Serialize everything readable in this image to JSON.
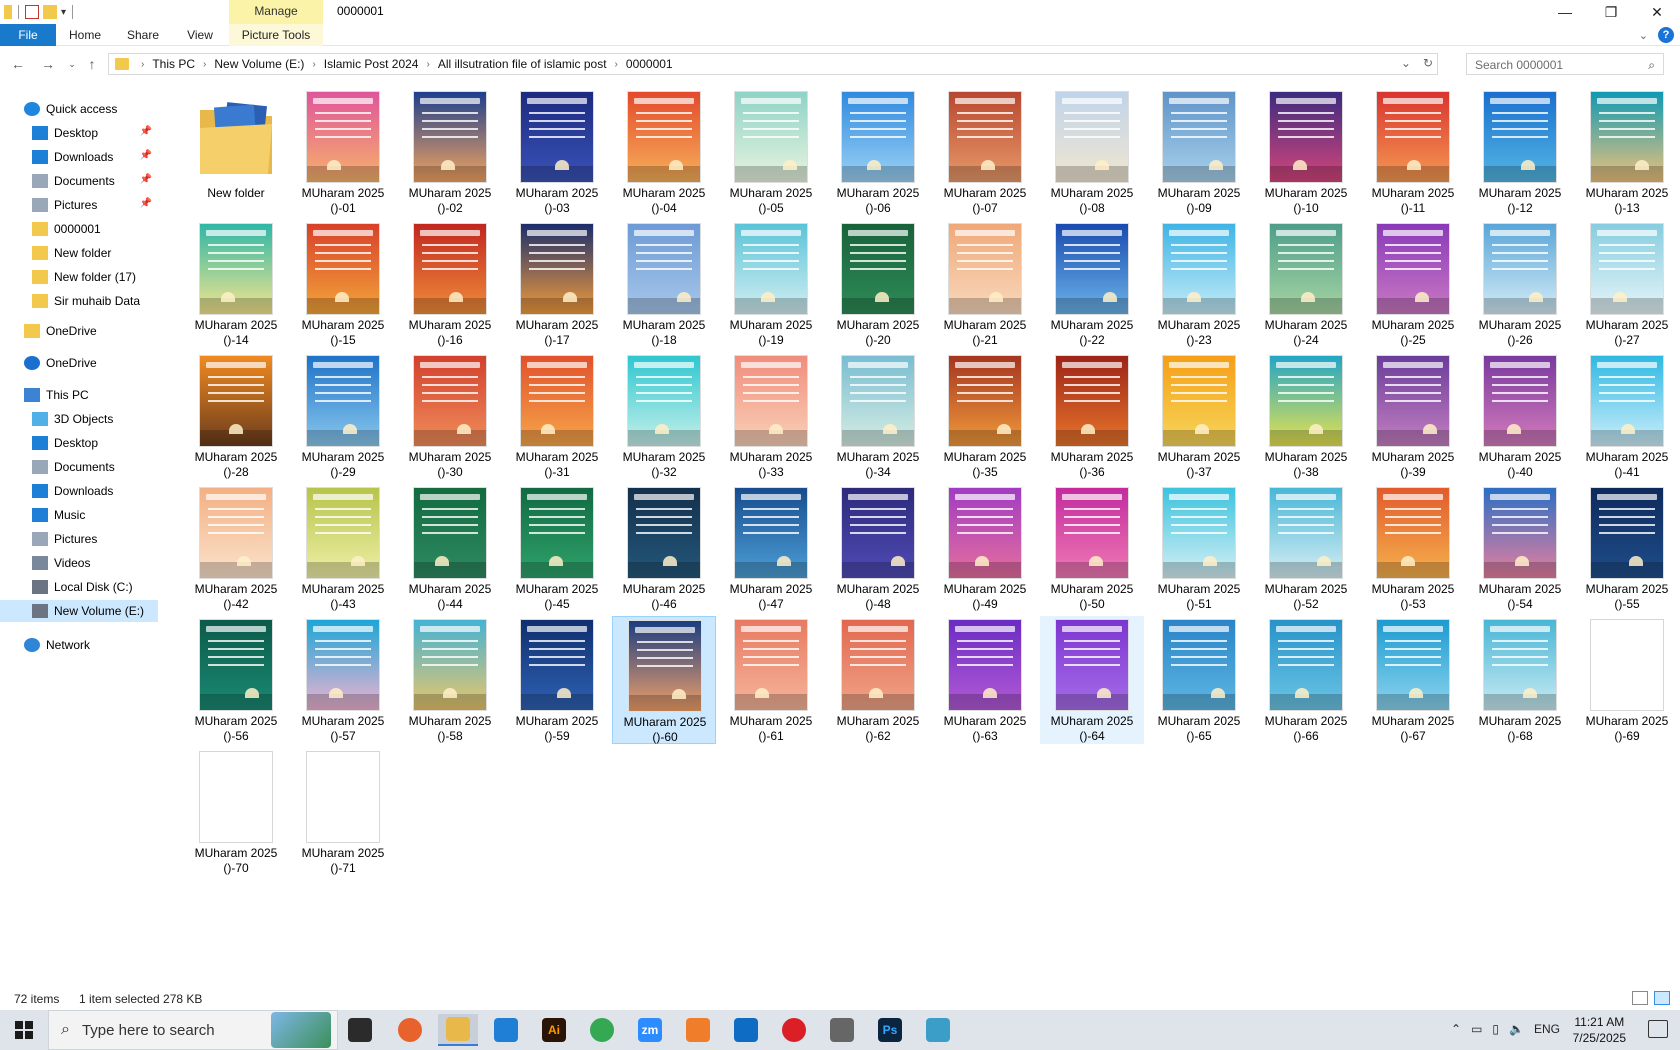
{
  "window": {
    "title": "0000001",
    "manage_label": "Manage",
    "controls": [
      "minimize-icon",
      "restore-icon",
      "close-icon"
    ]
  },
  "ribbon": {
    "file": "File",
    "home": "Home",
    "share": "Share",
    "view": "View",
    "picture_tools": "Picture Tools"
  },
  "address": {
    "crumbs": [
      "This PC",
      "New Volume (E:)",
      "Islamic Post 2024",
      "All illsutration file of islamic post",
      "0000001"
    ]
  },
  "search": {
    "placeholder": "Search 0000001"
  },
  "sidebar": {
    "items": [
      {
        "label": "Quick access",
        "icon": "star-icon"
      },
      {
        "label": "Desktop",
        "icon": "desktop-icon",
        "pinned": true
      },
      {
        "label": "Downloads",
        "icon": "download-icon",
        "pinned": true
      },
      {
        "label": "Documents",
        "icon": "documents-icon",
        "pinned": true
      },
      {
        "label": "Pictures",
        "icon": "pictures-icon",
        "pinned": true
      },
      {
        "label": "0000001",
        "icon": "folder-icon"
      },
      {
        "label": "New folder",
        "icon": "folder-icon"
      },
      {
        "label": "New folder (17)",
        "icon": "folder-icon"
      },
      {
        "label": "Sir muhaib Data",
        "icon": "folder-icon"
      },
      {
        "label": "OneDrive",
        "icon": "folder-icon"
      },
      {
        "label": "OneDrive",
        "icon": "cloud-icon"
      },
      {
        "label": "This PC",
        "icon": "computer-icon"
      },
      {
        "label": "3D Objects",
        "icon": "cube-icon"
      },
      {
        "label": "Desktop",
        "icon": "desktop-icon"
      },
      {
        "label": "Documents",
        "icon": "documents-icon"
      },
      {
        "label": "Downloads",
        "icon": "download-icon"
      },
      {
        "label": "Music",
        "icon": "music-icon"
      },
      {
        "label": "Pictures",
        "icon": "pictures-icon"
      },
      {
        "label": "Videos",
        "icon": "videos-icon"
      },
      {
        "label": "Local Disk (C:)",
        "icon": "drive-icon"
      },
      {
        "label": "New Volume (E:)",
        "icon": "drive-icon",
        "selected": true
      },
      {
        "label": "Network",
        "icon": "network-icon"
      }
    ]
  },
  "files": {
    "folder": {
      "label": "New folder"
    },
    "images": [
      {
        "label": "MUharam 2025\n()-01",
        "colors": [
          "#e0559a",
          "#f6b26b"
        ]
      },
      {
        "label": "MUharam 2025\n()-02",
        "colors": [
          "#1d3f8c",
          "#f4a460"
        ]
      },
      {
        "label": "MUharam 2025\n()-03",
        "colors": [
          "#1c2a80",
          "#3a53b8"
        ]
      },
      {
        "label": "MUharam 2025\n()-04",
        "colors": [
          "#e34a2b",
          "#f7b15a"
        ]
      },
      {
        "label": "MUharam 2025\n()-05",
        "colors": [
          "#8fd3c7",
          "#e8f4df"
        ]
      },
      {
        "label": "MUharam 2025\n()-06",
        "colors": [
          "#2f8ae0",
          "#9bd2f5"
        ]
      },
      {
        "label": "MUharam 2025\n()-07",
        "colors": [
          "#b8472f",
          "#e89a6a"
        ]
      },
      {
        "label": "MUharam 2025\n()-08",
        "colors": [
          "#bfd4ea",
          "#f1e6d0"
        ]
      },
      {
        "label": "MUharam 2025\n()-09",
        "colors": [
          "#5f94c9",
          "#a8d1ea"
        ]
      },
      {
        "label": "MUharam 2025\n()-10",
        "colors": [
          "#3c2b7f",
          "#d5467b"
        ]
      },
      {
        "label": "MUharam 2025\n()-11",
        "colors": [
          "#d9342f",
          "#f59a52"
        ]
      },
      {
        "label": "MUharam 2025\n()-12",
        "colors": [
          "#1a6fcf",
          "#54b7e3"
        ]
      },
      {
        "label": "MUharam 2025\n()-13",
        "colors": [
          "#0f9ab3",
          "#f0c27a"
        ]
      },
      {
        "label": "MUharam 2025\n()-14",
        "colors": [
          "#2fb7a6",
          "#f5e58c"
        ]
      },
      {
        "label": "MUharam 2025\n()-15",
        "colors": [
          "#d8402a",
          "#f3a53a"
        ]
      },
      {
        "label": "MUharam 2025\n()-16",
        "colors": [
          "#c1271f",
          "#f08c3a"
        ]
      },
      {
        "label": "MUharam 2025\n()-17",
        "colors": [
          "#1b2d6b",
          "#f29c3c"
        ]
      },
      {
        "label": "MUharam 2025\n()-18",
        "colors": [
          "#6d9bd6",
          "#a7c7ea"
        ]
      },
      {
        "label": "MUharam 2025\n()-19",
        "colors": [
          "#5bc4d8",
          "#d3eef2"
        ]
      },
      {
        "label": "MUharam 2025\n()-20",
        "colors": [
          "#18623a",
          "#2e8b57"
        ]
      },
      {
        "label": "MUharam 2025\n()-21",
        "colors": [
          "#f0a878",
          "#f9d9bd"
        ]
      },
      {
        "label": "MUharam 2025\n()-22",
        "colors": [
          "#1a4bb0",
          "#6bb3e8"
        ]
      },
      {
        "label": "MUharam 2025\n()-23",
        "colors": [
          "#3fb4e6",
          "#c5ecf7"
        ]
      },
      {
        "label": "MUharam 2025\n()-24",
        "colors": [
          "#4d9e8a",
          "#a8d5a2"
        ]
      },
      {
        "label": "MUharam 2025\n()-25",
        "colors": [
          "#8a3ab8",
          "#c979c2"
        ]
      },
      {
        "label": "MUharam 2025\n()-26",
        "colors": [
          "#59a6d8",
          "#d4ecf6"
        ]
      },
      {
        "label": "MUharam 2025\n()-27",
        "colors": [
          "#86cde0",
          "#e6f5f8"
        ]
      },
      {
        "label": "MUharam 2025\n()-28",
        "colors": [
          "#f08a21",
          "#6b3c1d"
        ]
      },
      {
        "label": "MUharam 2025\n()-29",
        "colors": [
          "#1e73c8",
          "#8ac8ee"
        ]
      },
      {
        "label": "MUharam 2025\n()-30",
        "colors": [
          "#d2412e",
          "#f08d5a"
        ]
      },
      {
        "label": "MUharam 2025\n()-31",
        "colors": [
          "#e2512b",
          "#f6a64a"
        ]
      },
      {
        "label": "MUharam 2025\n()-32",
        "colors": [
          "#2ec7d0",
          "#c7f0ea"
        ]
      },
      {
        "label": "MUharam 2025\n()-33",
        "colors": [
          "#f18d7c",
          "#f9d1b8"
        ]
      },
      {
        "label": "MUharam 2025\n()-34",
        "colors": [
          "#79bdd2",
          "#d6ede3"
        ]
      },
      {
        "label": "MUharam 2025\n()-35",
        "colors": [
          "#a5351f",
          "#f09a3b"
        ]
      },
      {
        "label": "MUharam 2025\n()-36",
        "colors": [
          "#9d2417",
          "#e7742b"
        ]
      },
      {
        "label": "MUharam 2025\n()-37",
        "colors": [
          "#f59f17",
          "#f7d65a"
        ]
      },
      {
        "label": "MUharam 2025\n()-38",
        "colors": [
          "#23a6c5",
          "#e8e24f"
        ]
      },
      {
        "label": "MUharam 2025\n()-39",
        "colors": [
          "#6a3d9a",
          "#c57fc1"
        ]
      },
      {
        "label": "MUharam 2025\n()-40",
        "colors": [
          "#7a3a9e",
          "#d37bbc"
        ]
      },
      {
        "label": "MUharam 2025\n()-41",
        "colors": [
          "#2fb9e3",
          "#cdeefb"
        ]
      },
      {
        "label": "MUharam 2025\n()-42",
        "colors": [
          "#f3b083",
          "#fbe3cd"
        ]
      },
      {
        "label": "MUharam 2025\n()-43",
        "colors": [
          "#b7c44a",
          "#eff0a8"
        ]
      },
      {
        "label": "MUharam 2025\n()-44",
        "colors": [
          "#136b3f",
          "#2e8a62"
        ]
      },
      {
        "label": "MUharam 2025\n()-45",
        "colors": [
          "#116a42",
          "#2fa36b"
        ]
      },
      {
        "label": "MUharam 2025\n()-46",
        "colors": [
          "#13304d",
          "#24577a"
        ]
      },
      {
        "label": "MUharam 2025\n()-47",
        "colors": [
          "#174d8f",
          "#4d9fd6"
        ]
      },
      {
        "label": "MUharam 2025\n()-48",
        "colors": [
          "#2d2a7c",
          "#4f4bb5"
        ]
      },
      {
        "label": "MUharam 2025\n()-49",
        "colors": [
          "#a13cc2",
          "#e56e9e"
        ]
      },
      {
        "label": "MUharam 2025\n()-50",
        "colors": [
          "#c32b9e",
          "#ef7ab4"
        ]
      },
      {
        "label": "MUharam 2025\n()-51",
        "colors": [
          "#3cc3de",
          "#d5f0f6"
        ]
      },
      {
        "label": "MUharam 2025\n()-52",
        "colors": [
          "#48b7d6",
          "#d6eef4"
        ]
      },
      {
        "label": "MUharam 2025\n()-53",
        "colors": [
          "#e25b2c",
          "#f5b14d"
        ]
      },
      {
        "label": "MUharam 2025\n()-54",
        "colors": [
          "#2b6fc4",
          "#e77f9f"
        ]
      },
      {
        "label": "MUharam 2025\n()-55",
        "colors": [
          "#0e2a5c",
          "#1f4d8a"
        ]
      },
      {
        "label": "MUharam 2025\n()-56",
        "colors": [
          "#0c5a4a",
          "#1a8a73"
        ]
      },
      {
        "label": "MUharam 2025\n()-57",
        "colors": [
          "#1ca6d6",
          "#f0b3d1"
        ]
      },
      {
        "label": "MUharam 2025\n()-58",
        "colors": [
          "#45b3d4",
          "#e9c66a"
        ]
      },
      {
        "label": "MUharam 2025\n()-59",
        "colors": [
          "#0f2f6e",
          "#2f61b3"
        ]
      },
      {
        "label": "MUharam 2025\n()-60",
        "colors": [
          "#1a3d80",
          "#f1a06a"
        ]
      },
      {
        "label": "MUharam 2025\n()-61",
        "colors": [
          "#e87a62",
          "#f5b59a"
        ]
      },
      {
        "label": "MUharam 2025\n()-62",
        "colors": [
          "#e2684f",
          "#f0a488"
        ]
      },
      {
        "label": "MUharam 2025\n()-63",
        "colors": [
          "#6b2cc2",
          "#b25ad6"
        ]
      },
      {
        "label": "MUharam 2025\n()-64",
        "colors": [
          "#7d35d0",
          "#a56de8"
        ]
      },
      {
        "label": "MUharam 2025\n()-65",
        "colors": [
          "#2a84c8",
          "#5db7e3"
        ]
      },
      {
        "label": "MUharam 2025\n()-66",
        "colors": [
          "#2793c9",
          "#6cc5e5"
        ]
      },
      {
        "label": "MUharam 2025\n()-67",
        "colors": [
          "#1d9bd0",
          "#8bd4ee"
        ]
      },
      {
        "label": "MUharam 2025\n()-68",
        "colors": [
          "#49b6d6",
          "#c8ebf2"
        ]
      },
      {
        "label": "MUharam 2025\n()-69",
        "colors": [
          "#ffffff",
          "#ffffff"
        ],
        "blank": true
      },
      {
        "label": "MUharam 2025\n()-70",
        "colors": [
          "#ffffff",
          "#ffffff"
        ],
        "blank": true
      },
      {
        "label": "MUharam 2025\n()-71",
        "colors": [
          "#ffffff",
          "#ffffff"
        ],
        "blank": true
      }
    ],
    "selected_index": 59,
    "highlight_index": 63
  },
  "status": {
    "count": "72 items",
    "selection": "1 item selected  278 KB"
  },
  "taskbar": {
    "search_placeholder": "Type here to search",
    "apps": [
      {
        "name": "task-view-icon",
        "label": ""
      },
      {
        "name": "firefox-icon",
        "label": ""
      },
      {
        "name": "file-explorer-icon",
        "label": "",
        "active": true
      },
      {
        "name": "vscode-icon",
        "label": ""
      },
      {
        "name": "illustrator-icon",
        "label": "Ai"
      },
      {
        "name": "chrome-icon",
        "label": ""
      },
      {
        "name": "zoom-icon",
        "label": "zm"
      },
      {
        "name": "xampp-icon",
        "label": ""
      },
      {
        "name": "outlook-icon",
        "label": ""
      },
      {
        "name": "creative-cloud-icon",
        "label": ""
      },
      {
        "name": "pen-tool-icon",
        "label": ""
      },
      {
        "name": "photoshop-icon",
        "label": "Ps"
      },
      {
        "name": "app-icon",
        "label": ""
      }
    ],
    "time": "11:21 AM",
    "date": "7/25/2025"
  }
}
